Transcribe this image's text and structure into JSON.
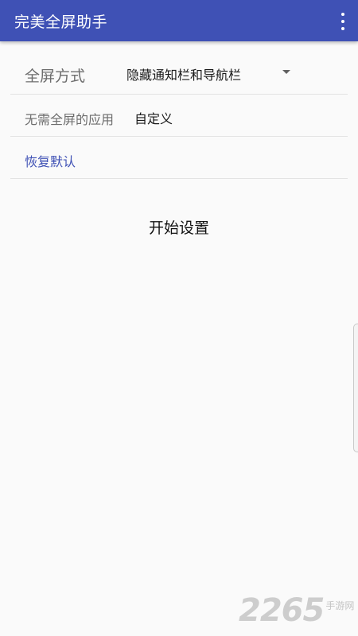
{
  "appbar": {
    "title": "完美全屏助手",
    "overflow_icon": "more-vert-icon"
  },
  "settings": {
    "fullscreen_mode_label": "全屏方式",
    "fullscreen_mode_value": "隐藏通知栏和导航栏",
    "excluded_apps_label": "无需全屏的应用",
    "excluded_apps_value": "自定义",
    "restore_default_label": "恢复默认"
  },
  "actions": {
    "start_label": "开始设置"
  },
  "watermark": {
    "number": "2265",
    "text": "手游网"
  },
  "colors": {
    "primary": "#3f51b5",
    "background": "#fafafa",
    "link": "#3f51b5"
  }
}
